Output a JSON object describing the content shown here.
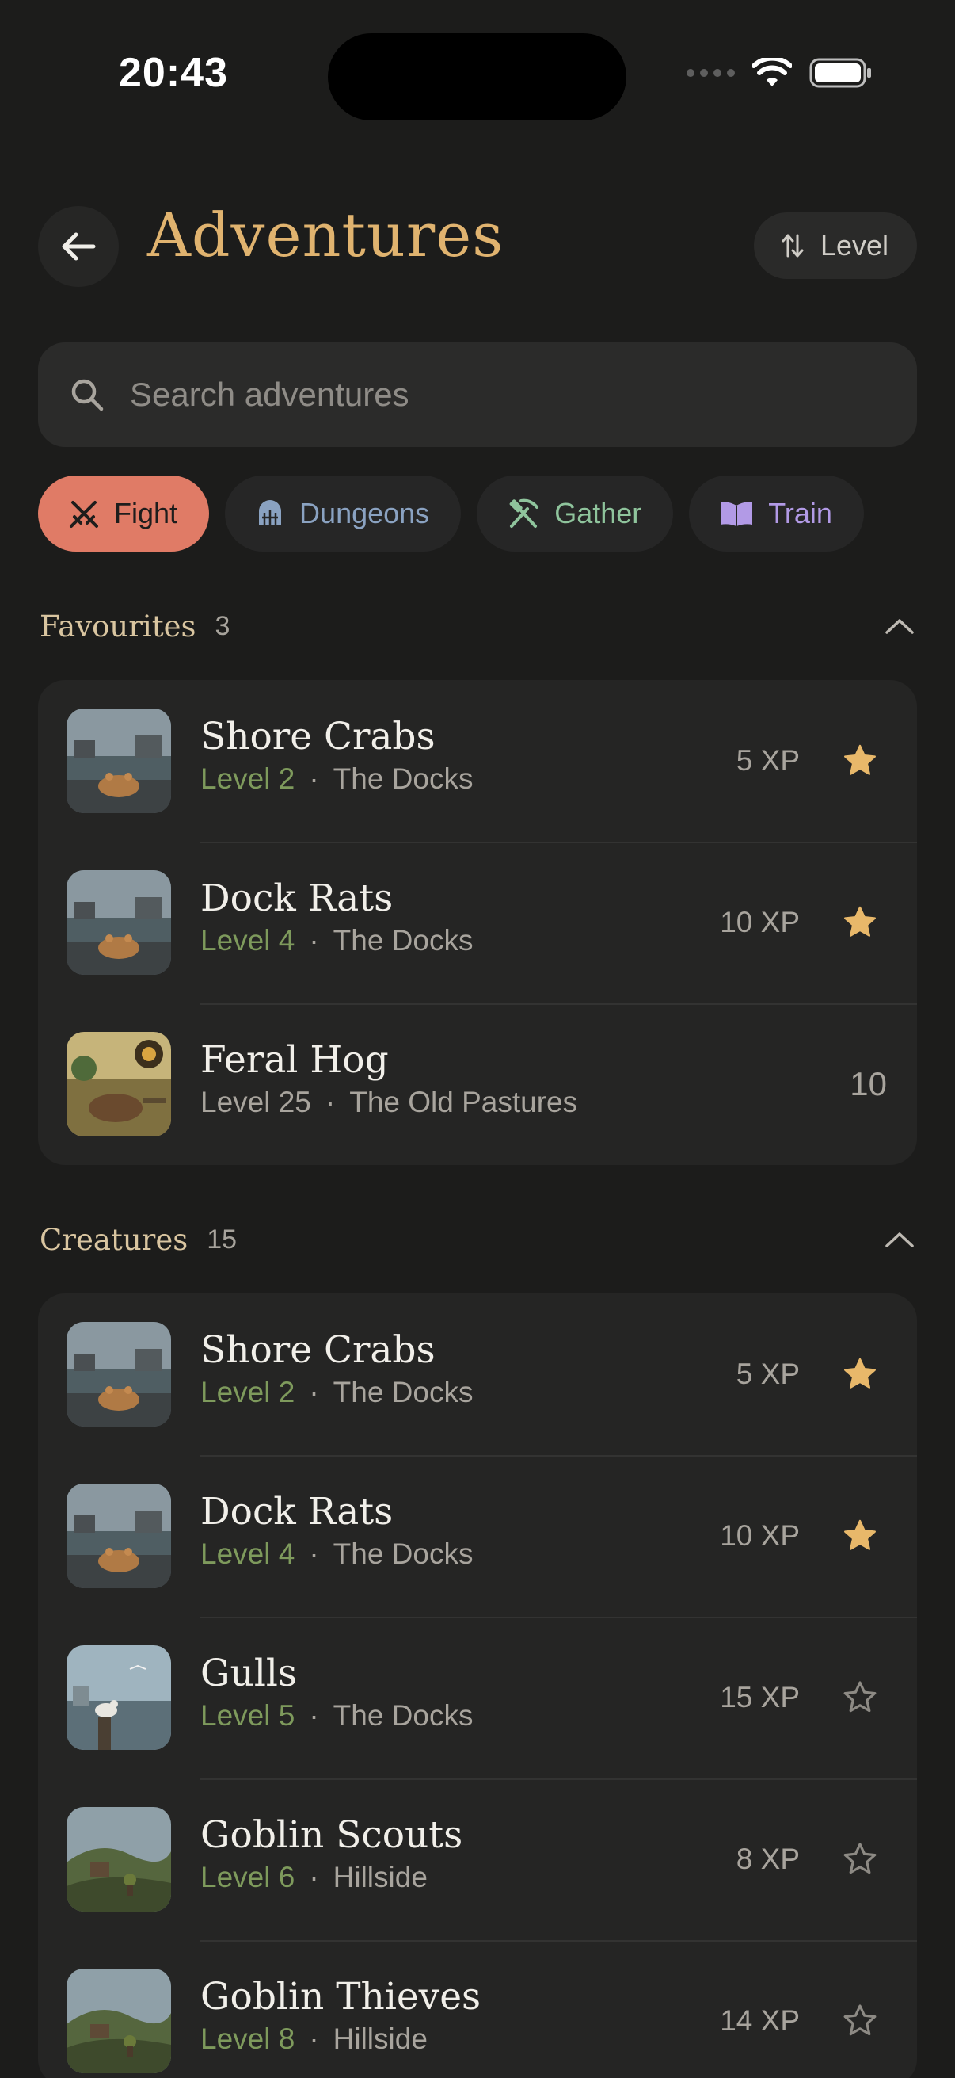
{
  "status": {
    "time": "20:43"
  },
  "header": {
    "title": "Adventures",
    "sort_label": "Level"
  },
  "search": {
    "placeholder": "Search adventures"
  },
  "chips": [
    {
      "label": "Fight",
      "icon": "crossed-swords-icon",
      "active": true
    },
    {
      "label": "Dungeons",
      "icon": "dungeon-gate-icon",
      "active": false
    },
    {
      "label": "Gather",
      "icon": "pickaxe-hammer-icon",
      "active": false
    },
    {
      "label": "Train",
      "icon": "open-book-icon",
      "active": false
    }
  ],
  "favourites": {
    "title": "Favourites",
    "count": "3",
    "items": [
      {
        "name": "Shore Crabs",
        "level": "Level 2",
        "location": "The Docks",
        "xp": "5 XP",
        "favourite": true,
        "thumb": "docks"
      },
      {
        "name": "Dock Rats",
        "level": "Level 4",
        "location": "The Docks",
        "xp": "10 XP",
        "favourite": true,
        "thumb": "docks"
      },
      {
        "name": "Feral Hog",
        "level": "Level 25",
        "location": "The Old Pastures",
        "xp": "10",
        "favourite": null,
        "thumb": "pasture"
      }
    ]
  },
  "creatures": {
    "title": "Creatures",
    "count": "15",
    "items": [
      {
        "name": "Shore Crabs",
        "level": "Level 2",
        "location": "The Docks",
        "xp": "5 XP",
        "favourite": true,
        "thumb": "docks"
      },
      {
        "name": "Dock Rats",
        "level": "Level 4",
        "location": "The Docks",
        "xp": "10 XP",
        "favourite": true,
        "thumb": "docks"
      },
      {
        "name": "Gulls",
        "level": "Level 5",
        "location": "The Docks",
        "xp": "15 XP",
        "favourite": false,
        "thumb": "sky"
      },
      {
        "name": "Goblin Scouts",
        "level": "Level 6",
        "location": "Hillside",
        "xp": "8 XP",
        "favourite": false,
        "thumb": "hill"
      },
      {
        "name": "Goblin Thieves",
        "level": "Level 8",
        "location": "Hillside",
        "xp": "14 XP",
        "favourite": false,
        "thumb": "hill"
      }
    ]
  },
  "colors": {
    "accent": "#e0b36f",
    "fight_chip": "#e07b66",
    "level_green": "#7e9a5c",
    "star_gold": "#e8b86a"
  }
}
